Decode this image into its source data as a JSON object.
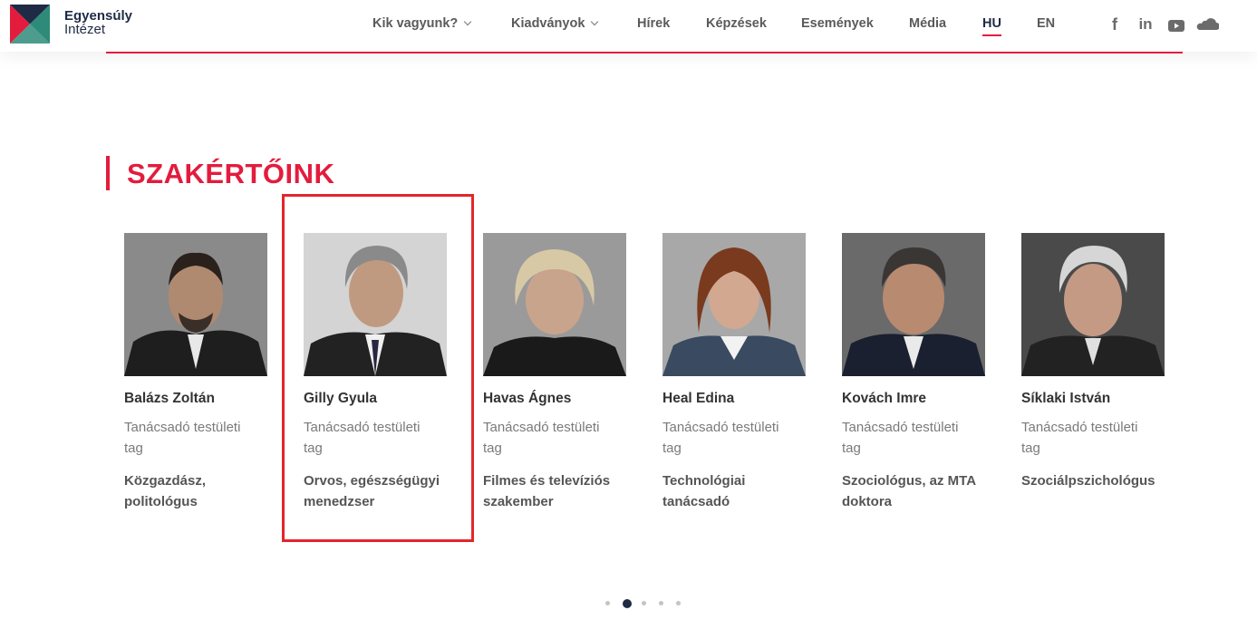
{
  "brand": {
    "line1": "Egyensúly",
    "line2": "Intézet",
    "colors": {
      "accent": "#e31c3d",
      "dark": "#1f2a44",
      "teal": "#2e8b7a"
    }
  },
  "nav": {
    "items": [
      {
        "label": "Kik vagyunk?",
        "dropdown": true
      },
      {
        "label": "Kiadványok",
        "dropdown": true
      },
      {
        "label": "Hírek"
      },
      {
        "label": "Képzések"
      },
      {
        "label": "Események"
      },
      {
        "label": "Média"
      },
      {
        "label": "HU",
        "active": true
      },
      {
        "label": "EN"
      }
    ],
    "social": [
      "facebook-icon",
      "linkedin-icon",
      "youtube-icon",
      "soundcloud-icon"
    ],
    "social_glyphs": {
      "facebook": "f",
      "linkedin": "in"
    }
  },
  "section": {
    "title": "SZAKÉRTŐINK"
  },
  "experts": [
    {
      "name": "Balázs Zoltán",
      "role": "Tanácsadó testületi tag",
      "profession": "Közgazdász, politológus"
    },
    {
      "name": "Gilly Gyula",
      "role": "Tanácsadó testületi tag",
      "profession": "Orvos, egészségügyi menedzser"
    },
    {
      "name": "Havas Ágnes",
      "role": "Tanácsadó testületi tag",
      "profession": "Filmes és televíziós szakember"
    },
    {
      "name": "Heal Edina",
      "role": "Tanácsadó testületi tag",
      "profession": "Technológiai tanácsadó"
    },
    {
      "name": "Kovách Imre",
      "role": "Tanácsadó testületi tag",
      "profession": "Szociológus, az MTA doktora"
    },
    {
      "name": "Síklaki István",
      "role": "Tanácsadó testületi tag",
      "profession": "Szociálpszichológus"
    }
  ],
  "carousel": {
    "page_count": 5,
    "active_index": 1
  }
}
